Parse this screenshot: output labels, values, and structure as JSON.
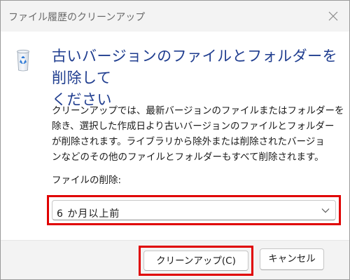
{
  "window": {
    "title": "ファイル履歴のクリーンアップ"
  },
  "heading": {
    "line1": "古いバージョンのファイルとフォルダーを削除して",
    "line2": "ください"
  },
  "description": {
    "lines": [
      "クリーンアップでは、最新バージョンのファイルまたはフォルダーを",
      "除き、選択した作成日より古いバージョンのファイルとフォルダー",
      "が削除されます。ライブラリから除外または削除されたバージョ",
      "ンなどのその他のファイルとフォルダーもすべて削除されます。"
    ]
  },
  "delete_files": {
    "label": "ファイルの削除:",
    "selected": "6 か月以上前"
  },
  "buttons": {
    "cleanup": "クリーンアップ(C)",
    "cancel": "キャンセル"
  },
  "colors": {
    "heading": "#1f3d8f",
    "highlight": "#e00000",
    "footer_bg": "#f3f3f3",
    "titlebar_bg": "#f3f3f3"
  },
  "icons": {
    "app": "recycle-bin-icon",
    "close": "close-icon",
    "dropdown": "chevron-down-icon"
  }
}
